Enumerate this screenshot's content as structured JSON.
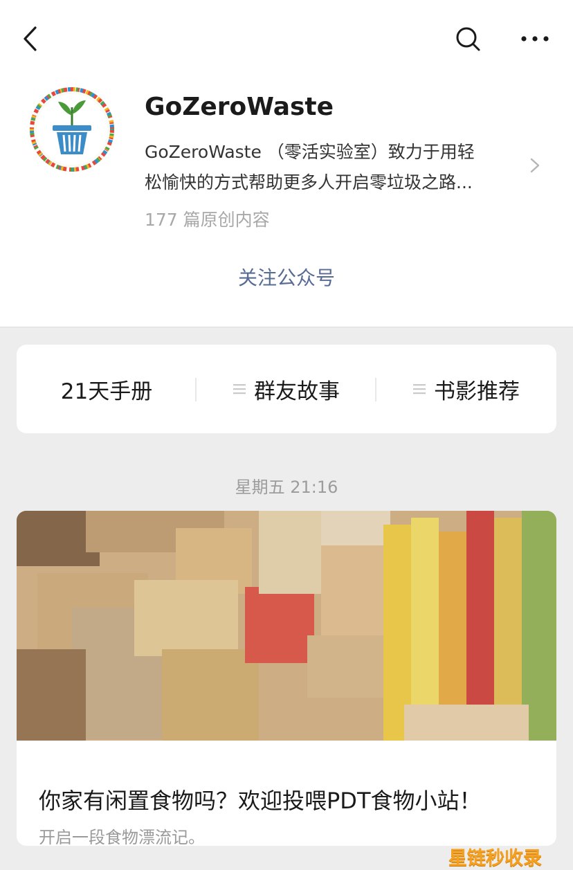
{
  "header": {
    "back_icon": "back-chevron-icon",
    "search_icon": "search-icon",
    "more_icon": "more-dots-icon"
  },
  "account": {
    "name": "GoZeroWaste",
    "description_line1": "GoZeroWaste （零活实验室）致力于用轻",
    "description_line2": "松愉快的方式帮助更多人开启零垃圾之路...",
    "article_count": "177 篇原创内容",
    "follow_label": "关注公众号",
    "logo_icon": "plant-in-bin-logo"
  },
  "menu": {
    "items": [
      {
        "label": "21天手册",
        "has_icon": false
      },
      {
        "label": "群友故事",
        "has_icon": true
      },
      {
        "label": "书影推荐",
        "has_icon": true
      }
    ]
  },
  "feed": {
    "timestamp": "星期五 21:16",
    "article": {
      "title": "你家有闲置食物吗？欢迎投喂PDT食物小站！",
      "subtitle": "开启一段食物漂流记。"
    }
  },
  "watermark": "星链秒收录",
  "colors": {
    "link": "#576b95",
    "background": "#ededed",
    "watermark": "#f5a020"
  }
}
